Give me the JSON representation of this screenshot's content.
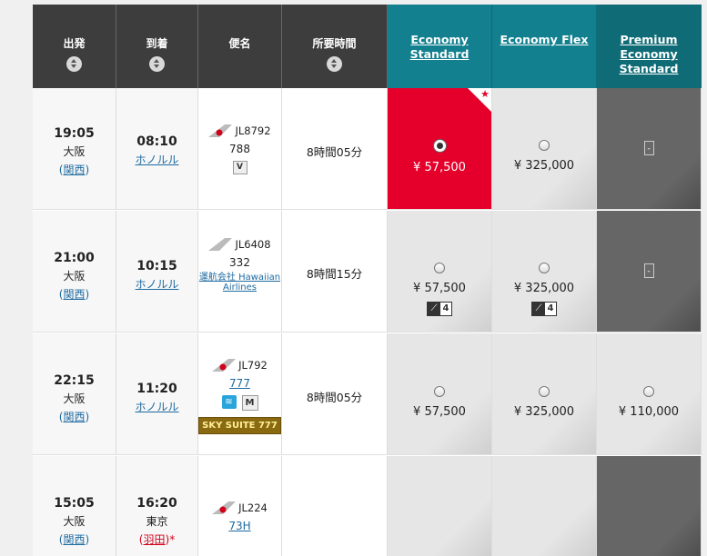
{
  "header": {
    "departure": "出発",
    "arrival": "到着",
    "flight": "便名",
    "duration": "所要時間",
    "fare_economy_standard": "Economy Standard",
    "fare_economy_flex": "Economy Flex",
    "fare_premium_economy_standard": "Premium Economy Standard"
  },
  "rows": [
    {
      "dep_time": "19:05",
      "dep_city": "大阪",
      "dep_airport": "関西",
      "arr_time": "08:10",
      "arr_city": "",
      "arr_airport_link": "ホノルル",
      "flight_no": "JL8792",
      "aircraft": "788",
      "duration": "8時間05分",
      "eco_std_price": "¥ 57,500",
      "eco_flex_price": "¥ 325,000",
      "eco_std_selected": true
    },
    {
      "dep_time": "21:00",
      "dep_city": "大阪",
      "dep_airport": "関西",
      "arr_time": "10:15",
      "arr_airport_link": "ホノルル",
      "flight_no": "JL6408",
      "aircraft": "332",
      "operated_by": "運航会社 Hawaiian Airlines",
      "duration": "8時間15分",
      "eco_std_price": "¥ 57,500",
      "eco_flex_price": "¥ 325,000",
      "seats_left": "4"
    },
    {
      "dep_time": "22:15",
      "dep_city": "大阪",
      "dep_airport": "関西",
      "arr_time": "11:20",
      "arr_airport_link": "ホノルル",
      "flight_no": "JL792",
      "aircraft": "777",
      "sky_suite": "SKY SUITE 777",
      "duration": "8時間05分",
      "eco_std_price": "¥ 57,500",
      "eco_flex_price": "¥ 325,000",
      "prem_price": "¥ 110,000"
    },
    {
      "dep_time": "15:05",
      "dep_city": "大阪",
      "dep_airport": "関西",
      "arr_time": "16:20",
      "arr_city": "東京",
      "arr_airport": "羽田",
      "flight_no": "JL224",
      "aircraft": "73H",
      "duration": ""
    }
  ],
  "colors": {
    "header_dark": "#3d3d3d",
    "teal": "#13808f",
    "selected_red": "#e4002b",
    "link_blue": "#1c6aa0"
  },
  "icons": {
    "sort": "sort-updown-icon",
    "tail": "jal-crane-tail-icon",
    "wifi": "wifi-icon"
  }
}
